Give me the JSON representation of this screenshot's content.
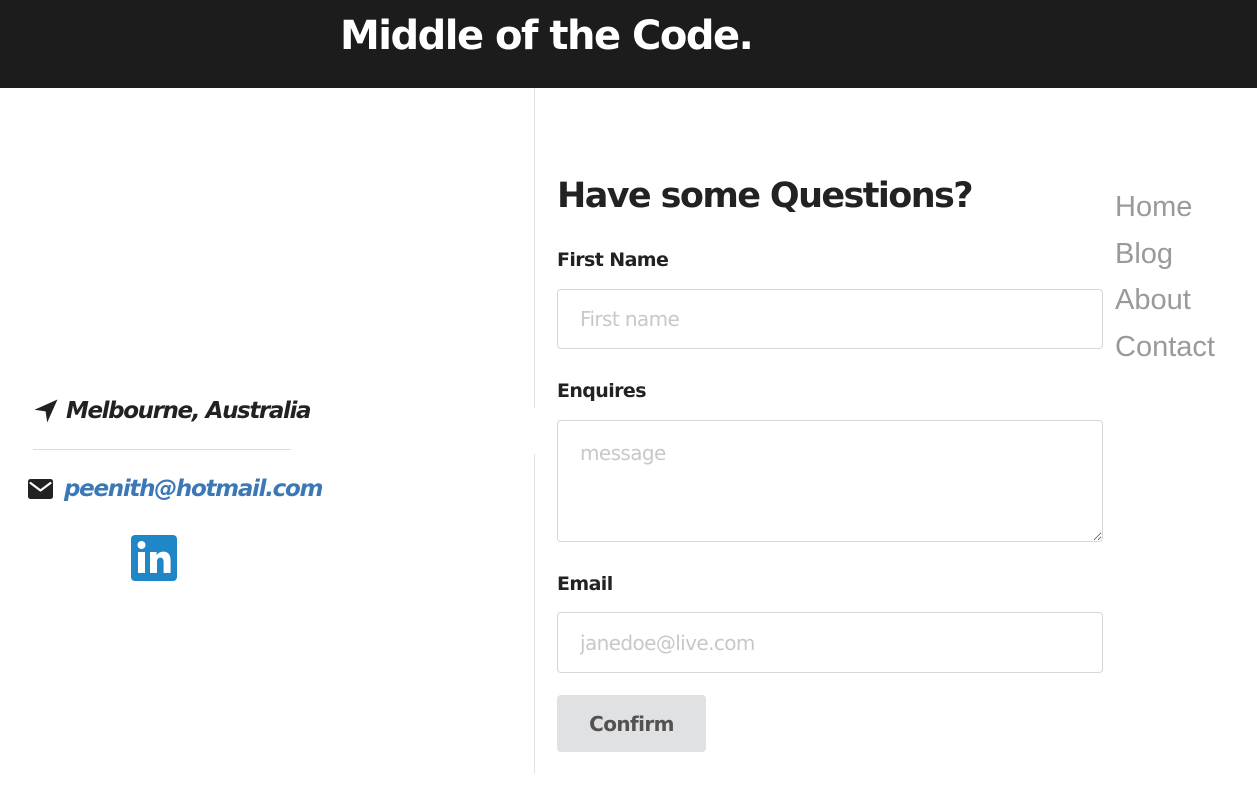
{
  "header": {
    "title": "Middle of the Code."
  },
  "contact_info": {
    "location": "Melbourne, Australia",
    "email": "peenith@hotmail.com",
    "location_icon": "location-arrow-icon",
    "email_icon": "envelope-icon",
    "social_icon": "linkedin-icon",
    "link_color": "#3c78b6",
    "linkedin_color": "#1f87c8"
  },
  "form": {
    "heading": "Have some Questions?",
    "first_name_label": "First Name",
    "first_name_placeholder": "First name",
    "first_name_value": "",
    "enquires_label": "Enquires",
    "message_placeholder": "message",
    "message_value": "",
    "email_label": "Email",
    "email_placeholder": "janedoe@live.com",
    "email_value": "",
    "submit_label": "Confirm"
  },
  "nav": {
    "items": [
      {
        "label": "Home"
      },
      {
        "label": "Blog"
      },
      {
        "label": "About"
      },
      {
        "label": "Contact"
      }
    ]
  },
  "colors": {
    "header_bg": "#1c1c1d",
    "nav_text": "#9a9a9a",
    "button_bg": "#e0e1e3"
  }
}
